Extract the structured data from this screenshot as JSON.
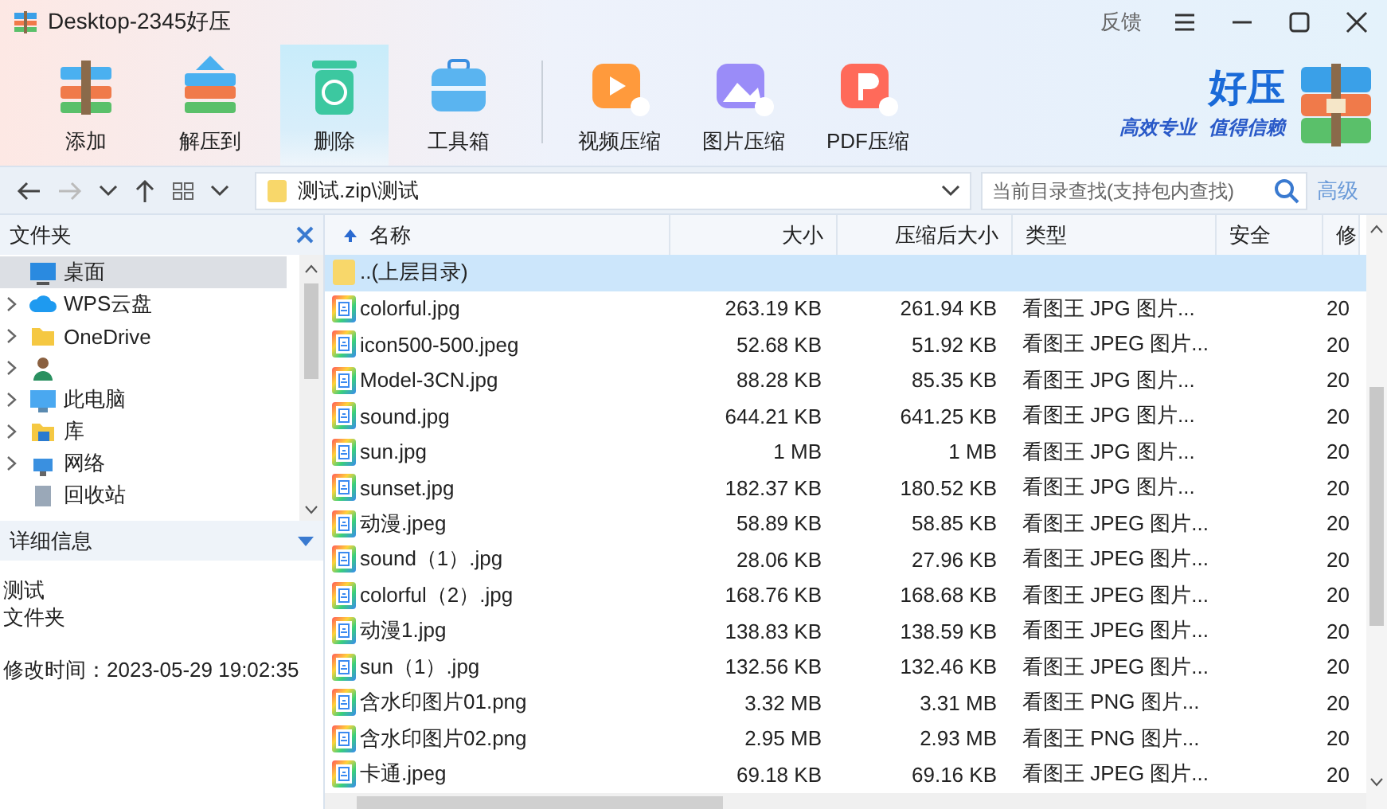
{
  "window": {
    "title": "Desktop-2345好压",
    "feedback": "反馈"
  },
  "toolbar": [
    {
      "label": "添加",
      "kind": "add",
      "selected": false
    },
    {
      "label": "解压到",
      "kind": "extract",
      "selected": false
    },
    {
      "label": "删除",
      "kind": "delete",
      "selected": true
    },
    {
      "label": "工具箱",
      "kind": "toolbox",
      "selected": false
    },
    {
      "label": "视频压缩",
      "kind": "video",
      "selected": false
    },
    {
      "label": "图片压缩",
      "kind": "image",
      "selected": false
    },
    {
      "label": "PDF压缩",
      "kind": "pdf",
      "selected": false
    }
  ],
  "brand": {
    "name": "好压",
    "slogan_1": "高效专业",
    "slogan_2": "值得信赖"
  },
  "nav": {
    "forward_disabled": true,
    "path": "测试.zip\\测试",
    "search_placeholder": "当前目录查找(支持包内查找)",
    "advanced": "高级"
  },
  "folder_panel": {
    "title": "文件夹",
    "items": [
      {
        "label": "桌面",
        "kind": "desktop",
        "selected": true,
        "expandable": false
      },
      {
        "label": "WPS云盘",
        "kind": "cloud",
        "selected": false,
        "expandable": true
      },
      {
        "label": "OneDrive",
        "kind": "folder",
        "selected": false,
        "expandable": true
      },
      {
        "kind": "user",
        "selected": false,
        "expandable": true
      },
      {
        "label": "此电脑",
        "kind": "pc",
        "selected": false,
        "expandable": true
      },
      {
        "label": "库",
        "kind": "library",
        "selected": false,
        "expandable": true
      },
      {
        "label": "网络",
        "kind": "network",
        "selected": false,
        "expandable": true
      },
      {
        "label": "回收站",
        "kind": "recycle",
        "selected": false,
        "expandable": false
      }
    ]
  },
  "details": {
    "title": "详细信息",
    "name": "测试",
    "type": "文件夹",
    "modified": "修改时间：2023-05-29 19:02:35"
  },
  "table": {
    "columns": [
      "名称",
      "大小",
      "压缩后大小",
      "类型",
      "安全",
      "修"
    ],
    "rows": [
      {
        "kind": "parent",
        "name": "..(上层目录)",
        "selected": true
      },
      {
        "kind": "file",
        "name": "colorful.jpg",
        "size": "263.19 KB",
        "packed": "261.94 KB",
        "type": "看图王 JPG 图片...",
        "modified": "20",
        "selected": false
      },
      {
        "kind": "file",
        "name": "icon500-500.jpeg",
        "size": "52.68 KB",
        "packed": "51.92 KB",
        "type": "看图王 JPEG 图片...",
        "modified": "20",
        "selected": false
      },
      {
        "kind": "file",
        "name": "Model-3CN.jpg",
        "size": "88.28 KB",
        "packed": "85.35 KB",
        "type": "看图王 JPG 图片...",
        "modified": "20",
        "selected": false
      },
      {
        "kind": "file",
        "name": "sound.jpg",
        "size": "644.21 KB",
        "packed": "641.25 KB",
        "type": "看图王 JPG 图片...",
        "modified": "20",
        "selected": false
      },
      {
        "kind": "file",
        "name": "sun.jpg",
        "size": "1 MB",
        "packed": "1 MB",
        "type": "看图王 JPG 图片...",
        "modified": "20",
        "selected": false
      },
      {
        "kind": "file",
        "name": "sunset.jpg",
        "size": "182.37 KB",
        "packed": "180.52 KB",
        "type": "看图王 JPG 图片...",
        "modified": "20",
        "selected": false
      },
      {
        "kind": "file",
        "name": "动漫.jpeg",
        "size": "58.89 KB",
        "packed": "58.85 KB",
        "type": "看图王 JPEG 图片...",
        "modified": "20",
        "selected": false
      },
      {
        "kind": "file",
        "name": "sound（1）.jpg",
        "size": "28.06 KB",
        "packed": "27.96 KB",
        "type": "看图王 JPEG 图片...",
        "modified": "20",
        "selected": false
      },
      {
        "kind": "file",
        "name": "colorful（2）.jpg",
        "size": "168.76 KB",
        "packed": "168.68 KB",
        "type": "看图王 JPEG 图片...",
        "modified": "20",
        "selected": false
      },
      {
        "kind": "file",
        "name": "动漫1.jpg",
        "size": "138.83 KB",
        "packed": "138.59 KB",
        "type": "看图王 JPEG 图片...",
        "modified": "20",
        "selected": false
      },
      {
        "kind": "file",
        "name": "sun（1）.jpg",
        "size": "132.56 KB",
        "packed": "132.46 KB",
        "type": "看图王 JPEG 图片...",
        "modified": "20",
        "selected": false
      },
      {
        "kind": "file",
        "name": "含水印图片01.png",
        "size": "3.32 MB",
        "packed": "3.31 MB",
        "type": "看图王 PNG 图片...",
        "modified": "20",
        "selected": false
      },
      {
        "kind": "file",
        "name": "含水印图片02.png",
        "size": "2.95 MB",
        "packed": "2.93 MB",
        "type": "看图王 PNG 图片...",
        "modified": "20",
        "selected": false
      },
      {
        "kind": "file",
        "name": "卡通.jpeg",
        "size": "69.18 KB",
        "packed": "69.16 KB",
        "type": "看图王 JPEG 图片...",
        "modified": "20",
        "selected": false
      }
    ]
  }
}
